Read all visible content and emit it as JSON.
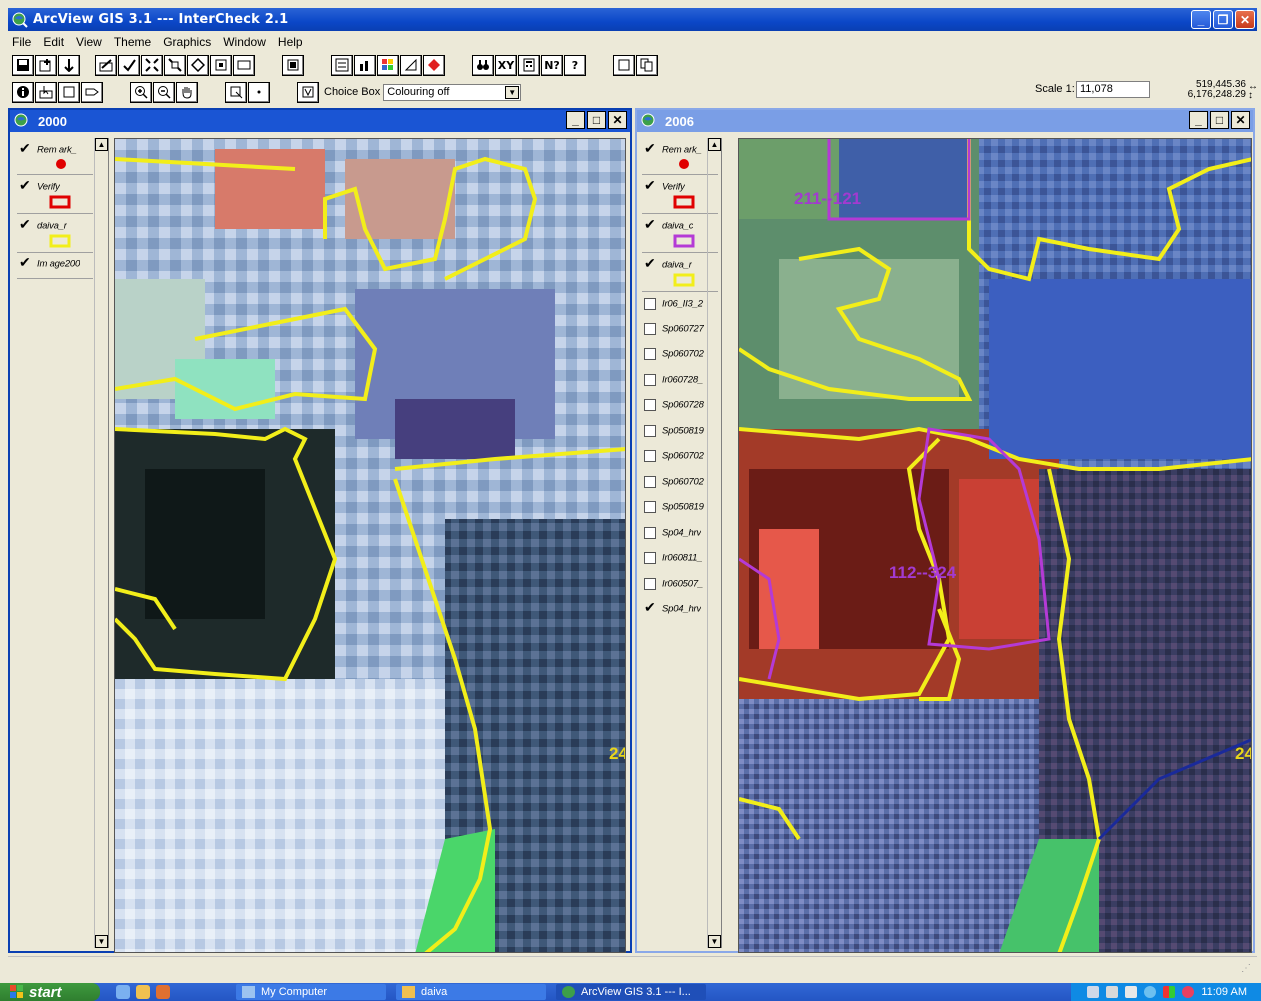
{
  "window": {
    "title": "ArcView GIS 3.1 --- InterCheck 2.1",
    "controls": [
      "_",
      "❐",
      "✕"
    ]
  },
  "menu": [
    "File",
    "Edit",
    "View",
    "Theme",
    "Graphics",
    "Window",
    "Help"
  ],
  "toolbar": {
    "find_icon": "binoculars-icon",
    "xy_label": "XY",
    "help_label": "?",
    "help_pointer_label": "N?",
    "choice_label": "Choice Box",
    "choice_value": "Colouring off",
    "scale_label": "Scale 1:",
    "scale_value": "11,078",
    "coord_x": "519,445.36",
    "coord_y": "6,176,248.29"
  },
  "views": [
    {
      "title": "2000",
      "layers": [
        {
          "name": "Rem ark_",
          "checked": true,
          "symbol": "red-dot"
        },
        {
          "name": "Verify",
          "checked": true,
          "symbol": "red-box"
        },
        {
          "name": "daiva_r",
          "checked": true,
          "symbol": "yellow-box"
        },
        {
          "name": "Im age200",
          "checked": true,
          "symbol": "none"
        }
      ],
      "map_labels": [
        "24"
      ]
    },
    {
      "title": "2006",
      "layers": [
        {
          "name": "Rem ark_",
          "checked": true,
          "symbol": "red-dot"
        },
        {
          "name": "Verify",
          "checked": true,
          "symbol": "red-box"
        },
        {
          "name": "daiva_c",
          "checked": true,
          "symbol": "purple-box"
        },
        {
          "name": "daiva_r",
          "checked": true,
          "symbol": "yellow-box"
        },
        {
          "name": "Ir06_II3_2",
          "checked": false,
          "symbol": "none"
        },
        {
          "name": "Sp060727",
          "checked": false,
          "symbol": "none"
        },
        {
          "name": "Sp060702",
          "checked": false,
          "symbol": "none"
        },
        {
          "name": "Ir060728_",
          "checked": false,
          "symbol": "none"
        },
        {
          "name": "Sp060728",
          "checked": false,
          "symbol": "none"
        },
        {
          "name": "Sp050819",
          "checked": false,
          "symbol": "none"
        },
        {
          "name": "Sp060702",
          "checked": false,
          "symbol": "none"
        },
        {
          "name": "Sp060702",
          "checked": false,
          "symbol": "none"
        },
        {
          "name": "Sp050819",
          "checked": false,
          "symbol": "none"
        },
        {
          "name": "Sp04_hrv",
          "checked": false,
          "symbol": "none"
        },
        {
          "name": "Ir060811_",
          "checked": false,
          "symbol": "none"
        },
        {
          "name": "Ir060507_",
          "checked": false,
          "symbol": "none"
        },
        {
          "name": "Sp04_hrv",
          "checked": true,
          "symbol": "none"
        }
      ],
      "map_labels": [
        "211--121",
        "112--324",
        "24"
      ]
    }
  ],
  "taskbar": {
    "start": "start",
    "tasks": [
      "My Computer",
      "daiva",
      "ArcView GIS 3.1 --- I..."
    ],
    "clock": "11:09 AM"
  },
  "colors": {
    "polygon_yellow": "#f2ee1a",
    "polygon_purple": "#b43ad6",
    "titlebar_blue": "#0b47c8",
    "label_purple": "#a23ad0",
    "label_yellow": "#e8d51a"
  }
}
